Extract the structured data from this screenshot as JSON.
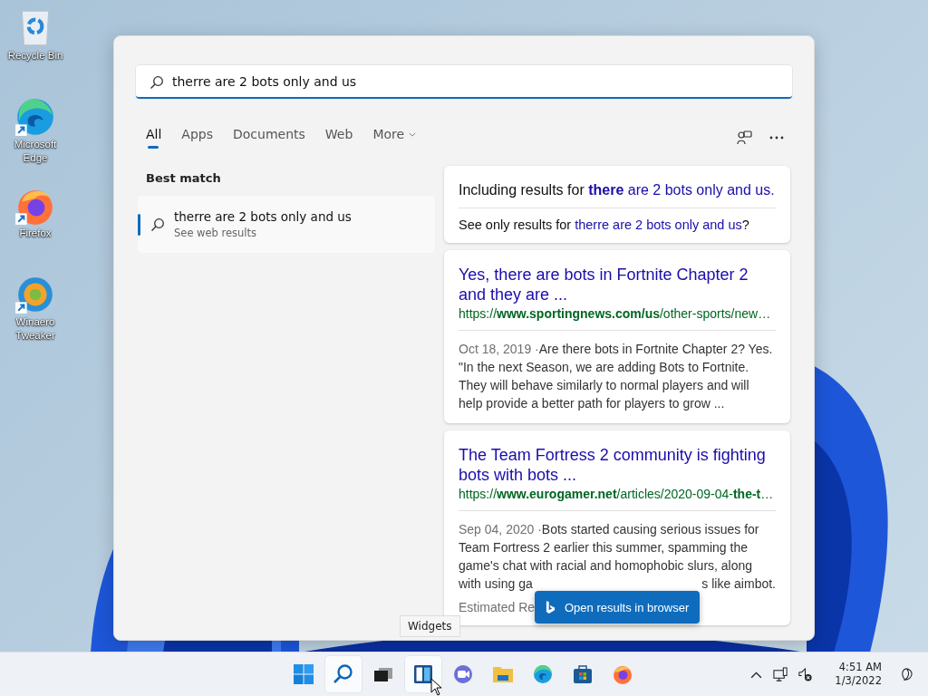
{
  "desktop_icons": [
    {
      "kind": "recycle-bin",
      "label": "Recycle Bin",
      "shortcut": false
    },
    {
      "kind": "edge",
      "label": "Microsoft Edge",
      "shortcut": true
    },
    {
      "kind": "firefox",
      "label": "Firefox",
      "shortcut": true
    },
    {
      "kind": "tweaker",
      "label": "Winaero Tweaker",
      "shortcut": true
    }
  ],
  "search": {
    "value": "therre are 2 bots only and us"
  },
  "tabs": [
    {
      "label": "All",
      "selected": true,
      "has_menu": false
    },
    {
      "label": "Apps",
      "selected": false,
      "has_menu": false
    },
    {
      "label": "Documents",
      "selected": false,
      "has_menu": false
    },
    {
      "label": "Web",
      "selected": false,
      "has_menu": false
    },
    {
      "label": "More",
      "selected": false,
      "has_menu": true
    }
  ],
  "best_match": {
    "heading": "Best match",
    "title": "therre are 2 bots only and us",
    "subtitle": "See web results",
    "selected": true
  },
  "spelling": {
    "including_prefix": "Including results for ",
    "including_query": "**there** are 2 bots only and us.",
    "only_prefix": "See only results for ",
    "only_query": "therre are 2 bots only and us",
    "only_suffix": "?"
  },
  "results": [
    {
      "title": "Yes, there are bots in Fortnite Chapter 2 and they are ...",
      "url": "https://**www.sportingnews.com/us**/other-sports/new…",
      "date": "Oct 18, 2019 ·",
      "snippet": "Are there bots in Fortnite Chapter 2? Yes. \"In the next Season, we are adding Bots to Fortnite. They will behave similarly to normal players and will help provide a better path for players to grow ..."
    },
    {
      "title": "The Team Fortress 2 community is fighting bots with bots ...",
      "url": "https://**www.eurogamer.net**/articles/2020-09-04-**the-t**…",
      "date": "Sep 04, 2020 ·",
      "snippet": "Bots started causing serious issues for Team Fortress 2 earlier this summer, spamming the game's chat with racial and homophobic slurs, along",
      "snippet_tail_left": "with using ga",
      "snippet_tail_right": "s like aimbot.",
      "reading_time": "Estimated Re"
    }
  ],
  "open_button": {
    "label": "Open results in browser"
  },
  "tooltip": {
    "text": "Widgets"
  },
  "taskbar": [
    {
      "kind": "start",
      "highlighted": false
    },
    {
      "kind": "search",
      "highlighted": true
    },
    {
      "kind": "task-view",
      "highlighted": false
    },
    {
      "kind": "widgets",
      "highlighted": true
    },
    {
      "kind": "chat",
      "highlighted": false
    },
    {
      "kind": "folder",
      "highlighted": false
    },
    {
      "kind": "edge",
      "highlighted": false
    },
    {
      "kind": "store",
      "highlighted": false
    },
    {
      "kind": "firefox",
      "highlighted": false
    }
  ],
  "clock": {
    "time": "4:51 AM",
    "date": "1/3/2022"
  }
}
